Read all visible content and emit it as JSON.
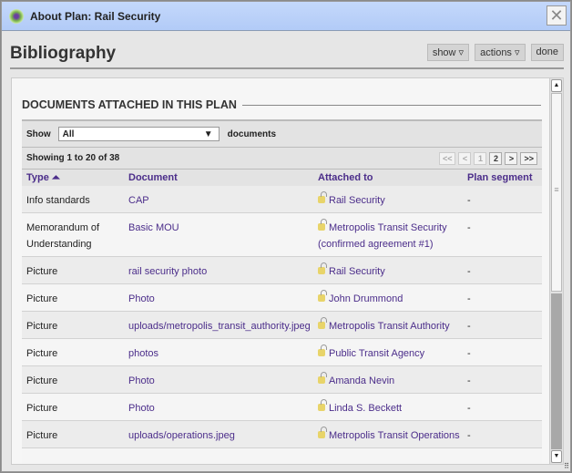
{
  "window": {
    "title": "About Plan: Rail Security",
    "close": "✕"
  },
  "header": {
    "title": "Bibliography",
    "show": "show ▿",
    "actions": "actions ▿",
    "done": "done"
  },
  "section": {
    "title": "DOCUMENTS ATTACHED IN THIS PLAN"
  },
  "filter": {
    "show_label": "Show",
    "value": "All",
    "suffix": "documents"
  },
  "paging": {
    "summary": "Showing 1 to 20 of 38",
    "first": "<<",
    "prev": "<",
    "pages": [
      "1",
      "2"
    ],
    "next": ">",
    "last": ">>"
  },
  "columns": {
    "type": "Type ⏶",
    "document": "Document",
    "attached": "Attached to",
    "segment": "Plan segment"
  },
  "rows": [
    {
      "type": "Info standards",
      "document": "CAP",
      "attached": "Rail Security",
      "segment": "-"
    },
    {
      "type": "Memorandum of Understanding",
      "document": "Basic MOU",
      "attached": "Metropolis Transit Security (confirmed agreement #1)",
      "segment": "-"
    },
    {
      "type": "Picture",
      "document": "rail security photo",
      "attached": "Rail Security",
      "segment": "-"
    },
    {
      "type": "Picture",
      "document": "Photo",
      "attached": "John Drummond",
      "segment": "-"
    },
    {
      "type": "Picture",
      "document": "uploads/metropolis_transit_authority.jpeg",
      "attached": "Metropolis Transit Authority",
      "segment": "-"
    },
    {
      "type": "Picture",
      "document": "photos",
      "attached": "Public Transit Agency",
      "segment": "-"
    },
    {
      "type": "Picture",
      "document": "Photo",
      "attached": "Amanda Nevin",
      "segment": "-"
    },
    {
      "type": "Picture",
      "document": "Photo",
      "attached": "Linda S. Beckett",
      "segment": "-"
    },
    {
      "type": "Picture",
      "document": "uploads/operations.jpeg",
      "attached": "Metropolis Transit Operations",
      "segment": "-"
    }
  ]
}
